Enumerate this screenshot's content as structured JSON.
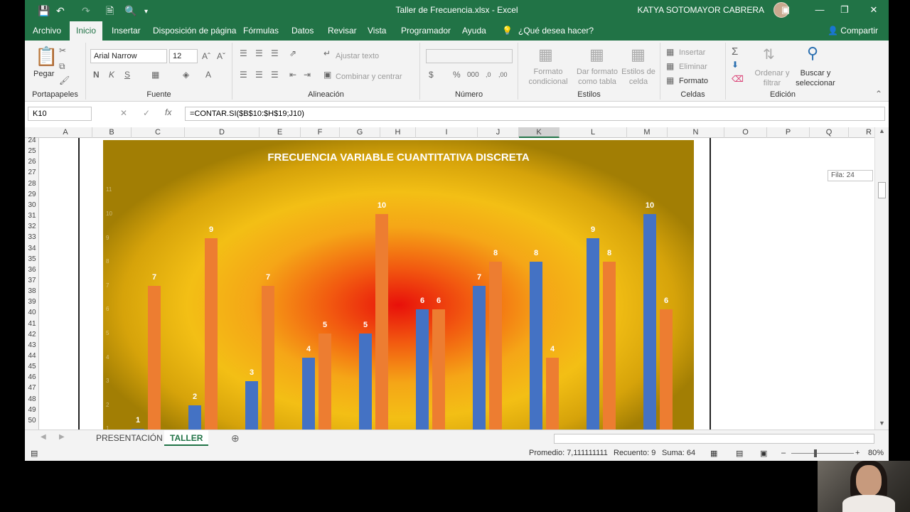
{
  "window": {
    "title": "Taller de Frecuencia.xlsx  -  Excel",
    "user": "KATYA SOTOMAYOR CABRERA",
    "accent_color": "#217346"
  },
  "menu": {
    "tabs": [
      "Archivo",
      "Inicio",
      "Insertar",
      "Disposición de página",
      "Fórmulas",
      "Datos",
      "Revisar",
      "Vista",
      "Programador",
      "Ayuda"
    ],
    "active_tab": "Inicio",
    "tell_me": "¿Qué desea hacer?",
    "share": "Compartir"
  },
  "ribbon": {
    "clipboard": {
      "paste": "Pegar",
      "label": "Portapapeles"
    },
    "font": {
      "name": "Arial Narrow",
      "size": "12",
      "label": "Fuente"
    },
    "alignment": {
      "wrap": "Ajustar texto",
      "merge": "Combinar y centrar",
      "label": "Alineación"
    },
    "number": {
      "label": "Número"
    },
    "styles": {
      "conditional": "Formato condicional",
      "as_table": "Dar formato como tabla",
      "cell_styles": "Estilos de celda",
      "label": "Estilos"
    },
    "cells": {
      "insert": "Insertar",
      "delete": "Eliminar",
      "format": "Formato",
      "label": "Celdas"
    },
    "editing": {
      "sort": "Ordenar y filtrar",
      "find": "Buscar y seleccionar",
      "label": "Edición"
    }
  },
  "formula_bar": {
    "name_box": "K10",
    "formula": "=CONTAR.SI($B$10:$H$19;J10)"
  },
  "grid": {
    "columns": [
      "A",
      "B",
      "C",
      "D",
      "E",
      "F",
      "G",
      "H",
      "I",
      "J",
      "K",
      "L",
      "M",
      "N",
      "O",
      "P",
      "Q",
      "R"
    ],
    "rows": [
      "24",
      "25",
      "26",
      "27",
      "28",
      "29",
      "30",
      "31",
      "32",
      "33",
      "34",
      "35",
      "36",
      "37",
      "38",
      "39",
      "40",
      "41",
      "42",
      "43",
      "44",
      "45",
      "46",
      "47",
      "48",
      "49",
      "50"
    ],
    "row_tooltip": "Fila: 24"
  },
  "chart_data": {
    "type": "bar",
    "title": "FRECUENCIA VARIABLE CUANTITATIVA DISCRETA",
    "ylim": [
      0,
      11
    ],
    "y_ticks": [
      1,
      2,
      3,
      4,
      5,
      6,
      7,
      8,
      9,
      10,
      11
    ],
    "series": [
      {
        "values": [
          1,
          2,
          3,
          4,
          5,
          6,
          7,
          8,
          9,
          10
        ],
        "color": "#4472c4"
      },
      {
        "values": [
          7,
          9,
          7,
          5,
          10,
          6,
          8,
          4,
          8,
          6
        ],
        "color": "#ed7d31"
      }
    ],
    "data_labels": true
  },
  "sheet_tabs": {
    "items": [
      "PRESENTACIÓN",
      "TALLER"
    ],
    "active": "TALLER"
  },
  "status": {
    "average": "Promedio: 7,111111111",
    "count": "Recuento: 9",
    "sum": "Suma: 64",
    "zoom": "80%"
  }
}
